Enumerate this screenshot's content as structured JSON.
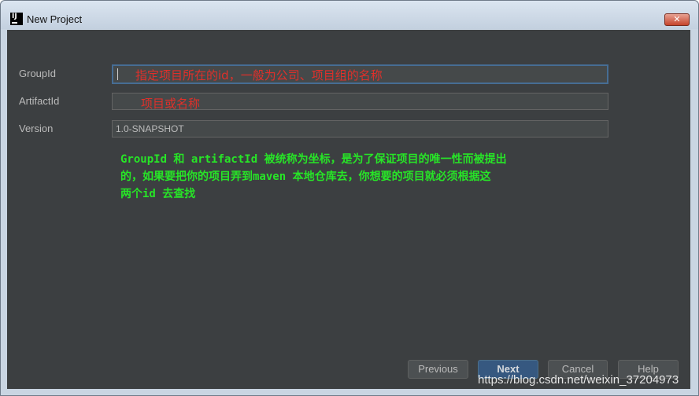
{
  "window": {
    "title": "New Project",
    "app_icon_text": "IJ",
    "close_symbol": "✕"
  },
  "form": {
    "groupid_label": "GroupId",
    "groupid_value": "",
    "artifactid_label": "ArtifactId",
    "artifactid_value": "",
    "version_label": "Version",
    "version_value": "1.0-SNAPSHOT"
  },
  "annotations": {
    "groupid_hint": "指定项目所在的id，一般为公司、项目组的名称",
    "artifactid_hint": "项目或名称",
    "note_lines": [
      "GroupId 和 artifactId 被统称为坐标，是为了保证项目的唯一性而被提出",
      "的，如果要把你的项目弄到maven 本地仓库去，你想要的项目就必须根据这",
      "两个id 去查找"
    ],
    "hint_color": "#e0302a",
    "note_color": "#27e427"
  },
  "buttons": {
    "previous_label": "Previous",
    "next_label": "Next",
    "cancel_label": "Cancel",
    "help_label": "Help"
  },
  "watermark": "https://blog.csdn.net/weixin_37204973",
  "colors": {
    "dialog_bg": "#3c3f41",
    "field_bg": "#45494a",
    "primary_button": "#365880"
  }
}
